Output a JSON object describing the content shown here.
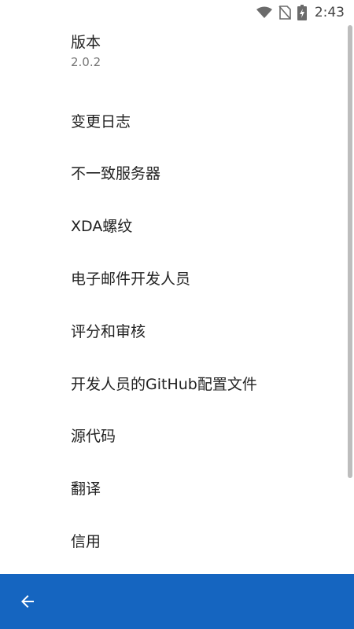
{
  "status_bar": {
    "time": "2:43",
    "icons": [
      "wifi-icon",
      "no-sim-icon",
      "battery-charging-icon"
    ]
  },
  "settings": {
    "items": [
      {
        "title": "版本",
        "summary": "2.0.2"
      },
      {
        "title": "变更日志"
      },
      {
        "title": "不一致服务器"
      },
      {
        "title": "XDA螺纹"
      },
      {
        "title": "电子邮件开发人员"
      },
      {
        "title": "评分和审核"
      },
      {
        "title": "开发人员的GitHub配置文件"
      },
      {
        "title": "源代码"
      },
      {
        "title": "翻译"
      },
      {
        "title": "信用"
      }
    ]
  },
  "bottom_bar": {
    "back_icon": "arrow-back-icon",
    "color": "#1565c0"
  }
}
